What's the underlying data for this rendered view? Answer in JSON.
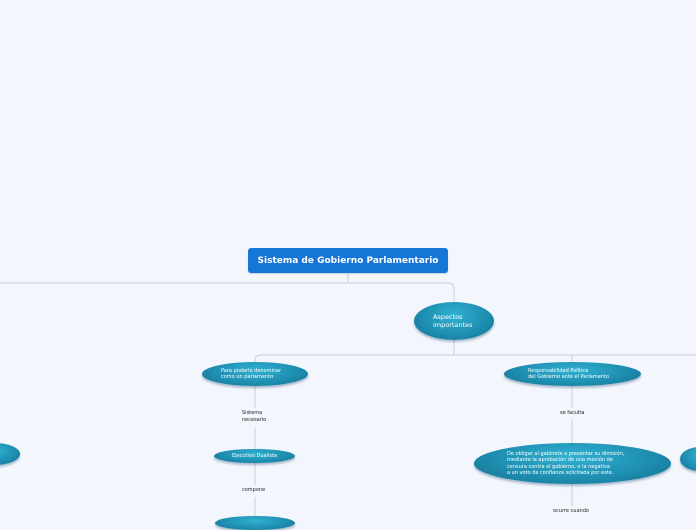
{
  "root": {
    "title": "Sistema de Gobierno Parlamentario"
  },
  "nodes": {
    "aspectos": "Aspectos\nimportantes",
    "para_poderlo": "Para poderlo denominar\ncomo un parlamento",
    "responsabilidad": "Responsabilidad Política\ndel Gobierno ante el Parlamento",
    "ejecutivo": "Ejecutivo Dualista",
    "obligar": "De obligar al gabinete a presentar su dimisión,\nmediante la aprobación de una moción de\ncensura contra el gobierno, o la negativa\na un voto de confianza solicitada por este."
  },
  "labels": {
    "sistema_necesario": "Sistema\nnecesario",
    "compone": "compone",
    "se_faculta": "se faculta",
    "ocurre_cuando": "ocurre cuando"
  },
  "colors": {
    "background": "#f3f6fd",
    "root": "#1676d8",
    "oval": "#1e8fb1",
    "connector": "#c9cfd8"
  }
}
